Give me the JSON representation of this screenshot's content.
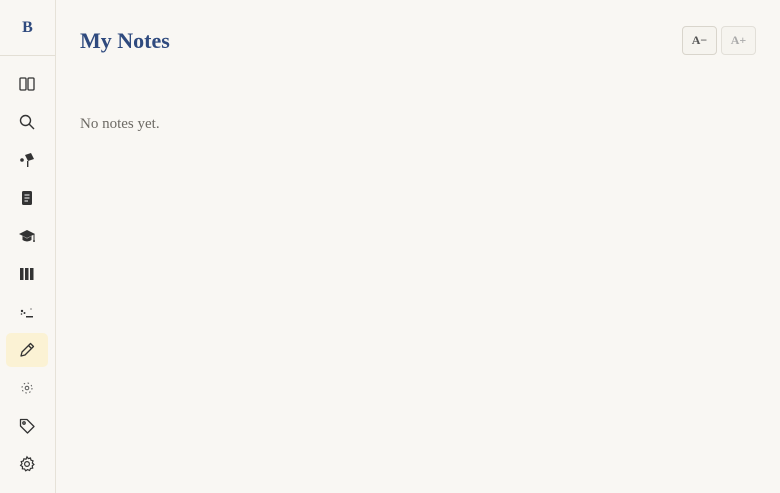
{
  "sidebar": {
    "logo": "B",
    "items": [
      {
        "name": "book-open",
        "icon": "book-icon"
      },
      {
        "name": "search",
        "icon": "search-icon"
      },
      {
        "name": "explore",
        "icon": "telescope-icon"
      },
      {
        "name": "document",
        "icon": "document-icon"
      },
      {
        "name": "learn",
        "icon": "graduation-cap-icon"
      },
      {
        "name": "library",
        "icon": "library-icon"
      },
      {
        "name": "terminal",
        "icon": "sparkle-icon"
      },
      {
        "name": "notes",
        "icon": "pencil-icon",
        "active": true
      },
      {
        "name": "graph",
        "icon": "orbit-icon"
      },
      {
        "name": "tags",
        "icon": "tag-icon"
      },
      {
        "name": "settings",
        "icon": "gear-icon"
      }
    ]
  },
  "main": {
    "title": "My Notes",
    "font_decrease": "A−",
    "font_increase": "A+",
    "empty_message": "No notes yet."
  },
  "colors": {
    "accent": "#2f4a7e",
    "background": "#f9f7f3",
    "active_highlight": "#fbf2d4"
  }
}
